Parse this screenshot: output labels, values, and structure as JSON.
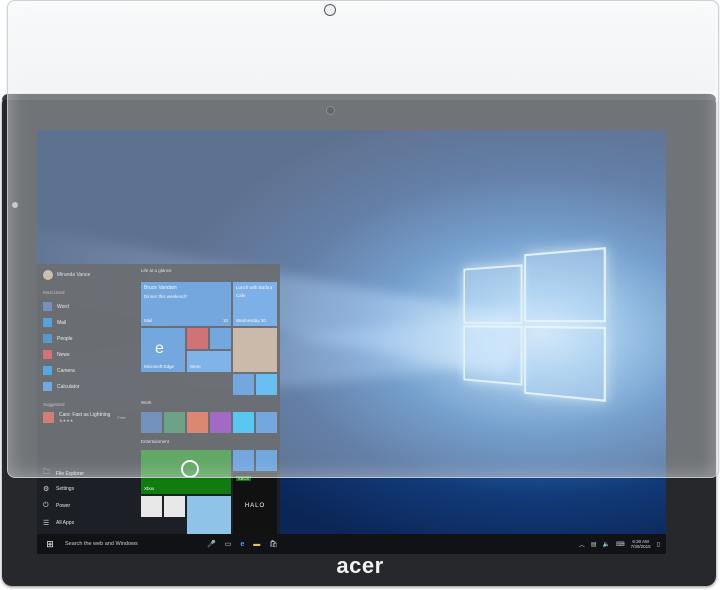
{
  "start_menu": {
    "user_name": "Miranda Vance",
    "most_used_label": "Most Used",
    "most_used": [
      {
        "label": "Word",
        "color": "#2b579a"
      },
      {
        "label": "Mail",
        "color": "#0072c6"
      },
      {
        "label": "People",
        "color": "#0063b1"
      },
      {
        "label": "News",
        "color": "#c1272d"
      },
      {
        "label": "Camera",
        "color": "#0078d7"
      },
      {
        "label": "Calculator",
        "color": "#2d7fd3"
      }
    ],
    "suggested_label": "Suggested",
    "suggested": {
      "label": "Cars: Fast as Lightning",
      "badge": "Free",
      "rating": "★★★★"
    },
    "bottom": [
      {
        "icon": "folder-icon",
        "glyph": "🗀",
        "label": "File Explorer"
      },
      {
        "icon": "gear-icon",
        "glyph": "⚙",
        "label": "Settings"
      },
      {
        "icon": "power-icon",
        "glyph": "⏻",
        "label": "Power"
      },
      {
        "icon": "all-apps-icon",
        "glyph": "☰",
        "label": "All Apps"
      }
    ],
    "groups": {
      "life": "Life at a glance",
      "work": "Work",
      "entertainment": "Entertainment"
    },
    "tiles": {
      "mail_title": "Bruce Vandam",
      "mail_sub": "Dinner this weekend?",
      "mail_label": "Mail",
      "mail_count": "10",
      "calendar_title": "Lunch with Barbra",
      "calendar_sub": "Cafe",
      "calendar_label": "Wednesday 30",
      "edge_label": "Microsoft Edge",
      "store_label": "Store",
      "xbox_label": "Xbox",
      "halo_tag": "XBOX",
      "halo_label": "HALO"
    }
  },
  "taskbar": {
    "search_placeholder": "Search the web and Windows",
    "time": "6:30 AM",
    "date": "7/30/2015"
  },
  "brand": "acer",
  "colors": {
    "bezel": "#26282c",
    "taskbar": "#101216",
    "tile_blue": "#2a7bd1",
    "xbox_green": "#107c10"
  }
}
